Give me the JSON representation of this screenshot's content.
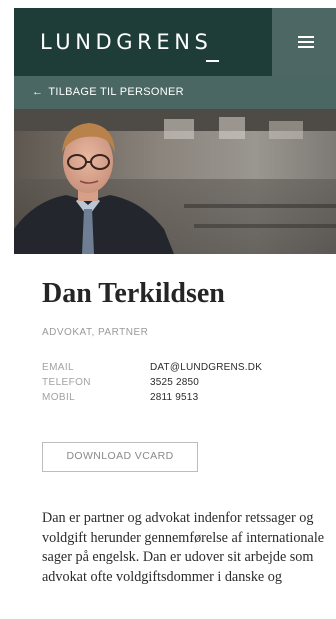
{
  "header": {
    "logo_text": "LUNDGRENS",
    "menu_icon": "hamburger-menu-icon"
  },
  "nav": {
    "back_arrow_icon": "arrow-left-icon",
    "back_label": "TILBAGE TIL PERSONER"
  },
  "profile": {
    "name": "Dan Terkildsen",
    "title": "ADVOKAT, PARTNER",
    "contacts": [
      {
        "label": "EMAIL",
        "value": "DAT@LUNDGRENS.DK"
      },
      {
        "label": "TELEFON",
        "value": "3525 2850"
      },
      {
        "label": "MOBIL",
        "value": "2811 9513"
      }
    ],
    "vcard_label": "DOWNLOAD VCARD",
    "bio": "Dan er partner og advokat indenfor retssager og voldgift herunder gennemførelse af internationale sager på engelsk. Dan er udover sit arbejde som advokat ofte voldgiftsdommer i danske og"
  },
  "colors": {
    "brand_dark": "#1f3d38",
    "brand_mid": "#4a6763",
    "menu_bg": "#4d6864",
    "text": "#252525",
    "muted": "#9a9a9a"
  }
}
